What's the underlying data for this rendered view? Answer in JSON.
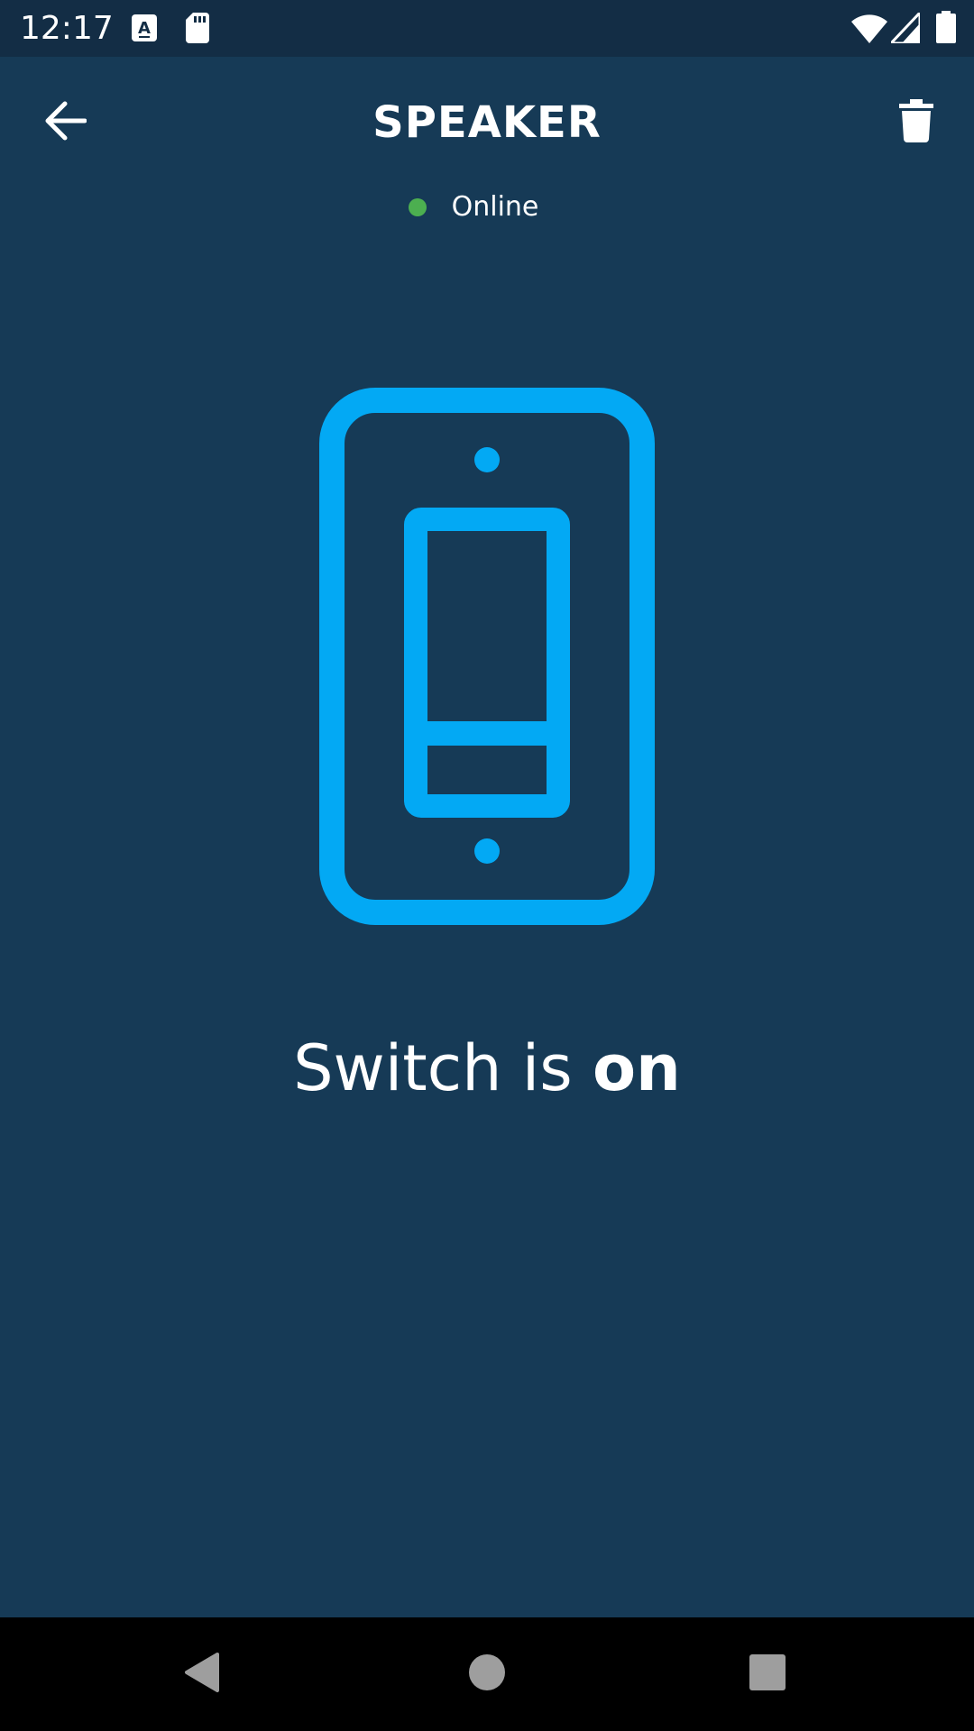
{
  "status_bar": {
    "time": "12:17",
    "icons": [
      "a-notification-icon",
      "sd-card-icon",
      "wifi-icon",
      "cell-signal-icon",
      "battery-icon"
    ]
  },
  "app_bar": {
    "title": "SPEAKER",
    "back_icon": "arrow-back-icon",
    "delete_icon": "trash-icon"
  },
  "device": {
    "status_text": "Online",
    "status_color": "#4caf50"
  },
  "switch": {
    "state_prefix": "Switch is ",
    "state_value": "on",
    "accent_color": "#03a9f4"
  },
  "nav_bar": {
    "icons": [
      "nav-back-icon",
      "nav-home-icon",
      "nav-recents-icon"
    ]
  },
  "colors": {
    "background": "#163a56",
    "status_bar": "#132d45",
    "nav_bar": "#000000"
  }
}
